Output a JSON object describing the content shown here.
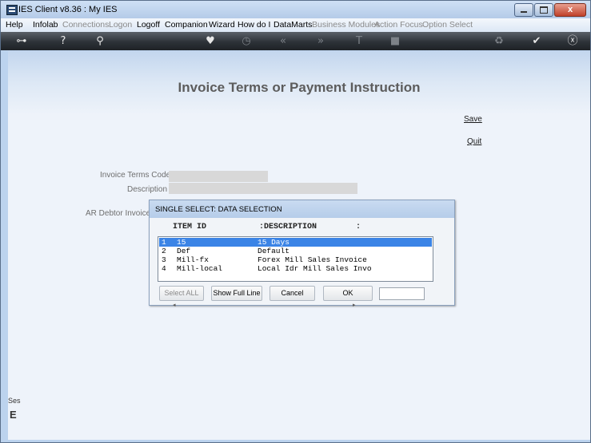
{
  "window": {
    "title": "IES Client v8.36 : My IES"
  },
  "menu": {
    "items": [
      {
        "label": "Help",
        "enabled": true
      },
      {
        "label": "Infolab",
        "enabled": true
      },
      {
        "label": "Connections",
        "enabled": false
      },
      {
        "label": "Logon",
        "enabled": false
      },
      {
        "label": "Logoff",
        "enabled": true
      },
      {
        "label": "Companion",
        "enabled": true
      },
      {
        "label": "Wizard",
        "enabled": true
      },
      {
        "label": "How do I",
        "enabled": true
      },
      {
        "label": "DataMarts",
        "enabled": true
      },
      {
        "label": "Business Modules",
        "enabled": false
      },
      {
        "label": "Action Focus",
        "enabled": false
      },
      {
        "label": "Option Select",
        "enabled": false
      }
    ]
  },
  "toolbar": {
    "icons": [
      "key-icon",
      "help-icon",
      "search-icon",
      "heart-icon",
      "clock-icon",
      "back-icon",
      "forward-icon",
      "text-icon",
      "stop-icon",
      "recycle-icon",
      "check-icon",
      "close-icon"
    ]
  },
  "page": {
    "title": "Invoice Terms or Payment Instruction",
    "save_label": "Save",
    "quit_label": "Quit",
    "fields": {
      "invoice_terms_code_label": "Invoice Terms Code",
      "description_label": "Description",
      "ar_debtor_label": "AR Debtor Invoice Te"
    },
    "side_fragment_1": "Ses",
    "side_fragment_2": "E"
  },
  "dialog": {
    "title": "SINGLE SELECT: DATA SELECTION",
    "col_item_id": "ITEM ID",
    "col_description": ":DESCRIPTION",
    "col_end": ":",
    "rows": [
      {
        "num": "1",
        "id": "15",
        "description": "15 Days",
        "selected": true
      },
      {
        "num": "2",
        "id": "Def",
        "description": "Default",
        "selected": false
      },
      {
        "num": "3",
        "id": "Mill-fx",
        "description": "Forex Mill Sales Invoice",
        "selected": false
      },
      {
        "num": "4",
        "id": "Mill-local",
        "description": "Local Idr Mill Sales Invo",
        "selected": false
      }
    ],
    "buttons": {
      "select_all": "Select ALL",
      "show_full_line": "Show Full Line",
      "cancel": "Cancel",
      "ok": "OK"
    },
    "scroll_left": "◂",
    "scroll_right": "▸"
  }
}
